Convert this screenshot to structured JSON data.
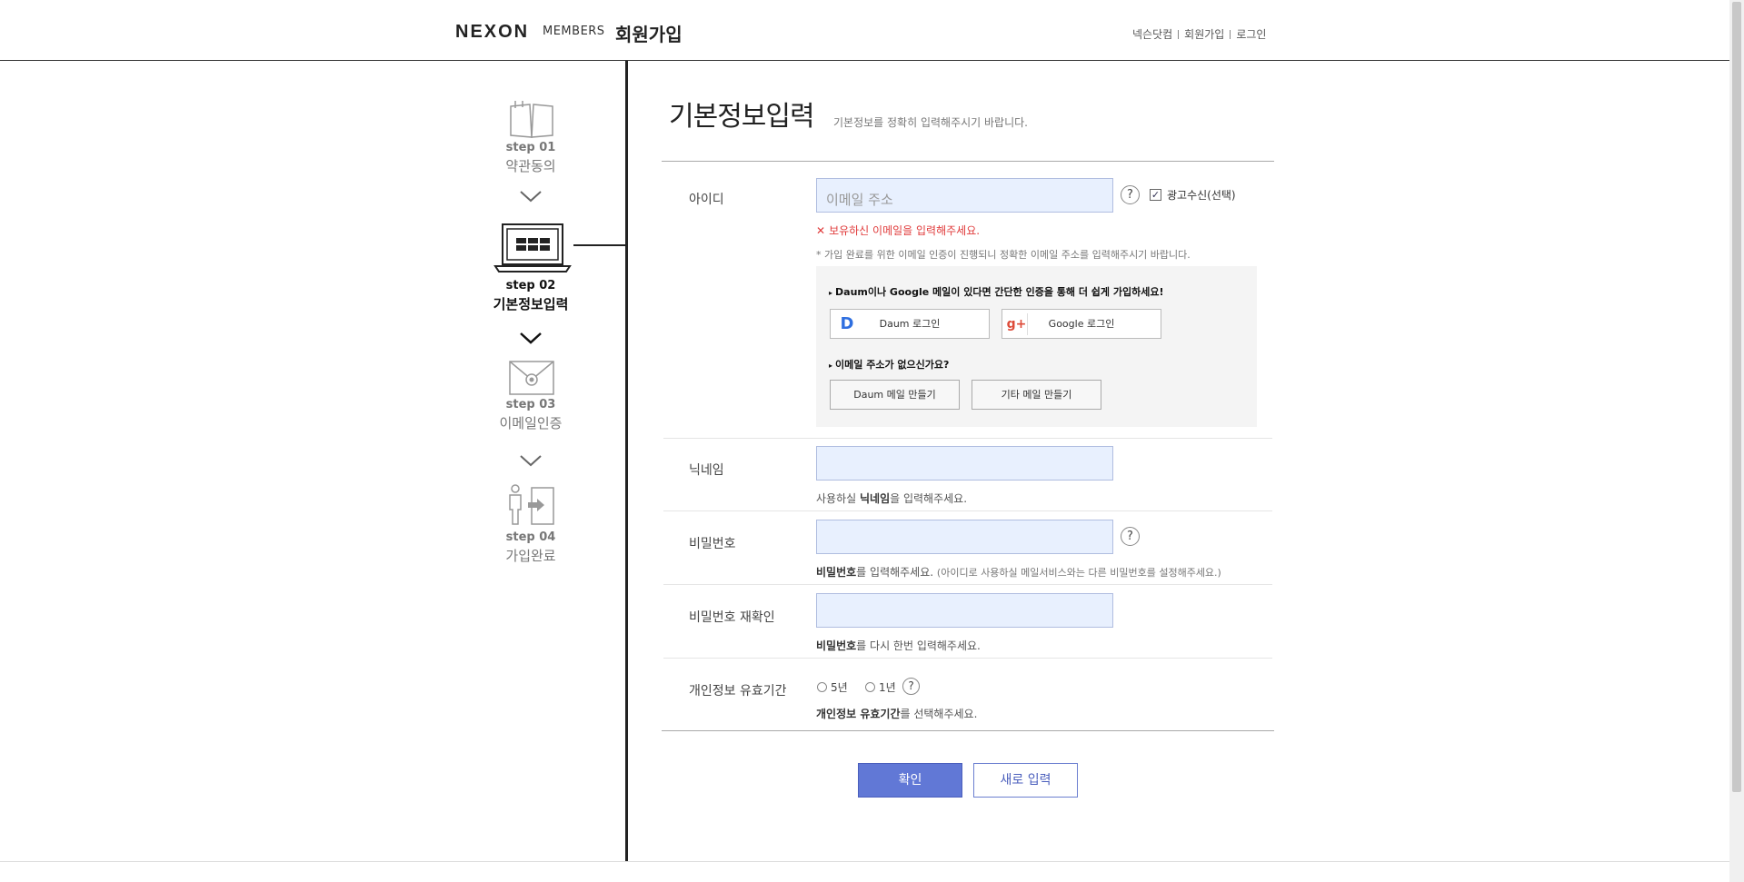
{
  "header": {
    "logo": "NEXON",
    "logo_sub": "MEMBERS",
    "title": "회원가입",
    "util_links": [
      "넥슨닷컴",
      "회원가입",
      "로그인"
    ]
  },
  "steps": [
    {
      "num": "step 01",
      "label": "약관동의",
      "icon": "book-icon"
    },
    {
      "num": "step 02",
      "label": "기본정보입력",
      "icon": "laptop-icon"
    },
    {
      "num": "step 03",
      "label": "이메일인증",
      "icon": "envelope-icon"
    },
    {
      "num": "step 04",
      "label": "가입완료",
      "icon": "person-door-icon"
    }
  ],
  "main": {
    "title": "기본정보입력",
    "subtitle": "기본정보를 정확히 입력해주시기 바랍니다."
  },
  "id_row": {
    "label": "아이디",
    "placeholder": "이메일 주소",
    "ad_checkbox_label": "광고수신(선택)",
    "ad_checked": true,
    "error": "보유하신 이메일을 입력해주세요.",
    "note": "* 가입 완료를 위한 이메일 인증이 진행되니 정확한 이메일 주소를 입력해주시기 바랍니다."
  },
  "social": {
    "title1": "Daum이나 Google 메일이 있다면 간단한 인증을 통해 더 쉽게 가입하세요!",
    "daum_login": "Daum 로그인",
    "google_login": "Google 로그인",
    "title2": "이메일 주소가 없으신가요?",
    "daum_mail": "Daum 메일 만들기",
    "other_mail": "기타 메일 만들기"
  },
  "nickname_row": {
    "label": "닉네임",
    "hint_pre": "사용하실 ",
    "hint_bold": "닉네임",
    "hint_post": "을 입력해주세요."
  },
  "password_row": {
    "label": "비밀번호",
    "hint_bold": "비밀번호",
    "hint_post": "를 입력해주세요.",
    "hint_small": "(아이디로 사용하실 메일서비스와는 다른 비밀번호를 설정해주세요.)"
  },
  "password_confirm_row": {
    "label": "비밀번호 재확인",
    "hint_bold": "비밀번호",
    "hint_post": "를 다시 한번 입력해주세요."
  },
  "privacy_row": {
    "label": "개인정보 유효기간",
    "options": [
      "5년",
      "1년"
    ],
    "hint_bold": "개인정보 유효기간",
    "hint_post": "를 선택해주세요."
  },
  "buttons": {
    "confirm": "확인",
    "reset": "새로 입력"
  },
  "colors": {
    "accent": "#6178d6",
    "error": "#e03a3a",
    "input_bg": "#e8f0fe"
  }
}
